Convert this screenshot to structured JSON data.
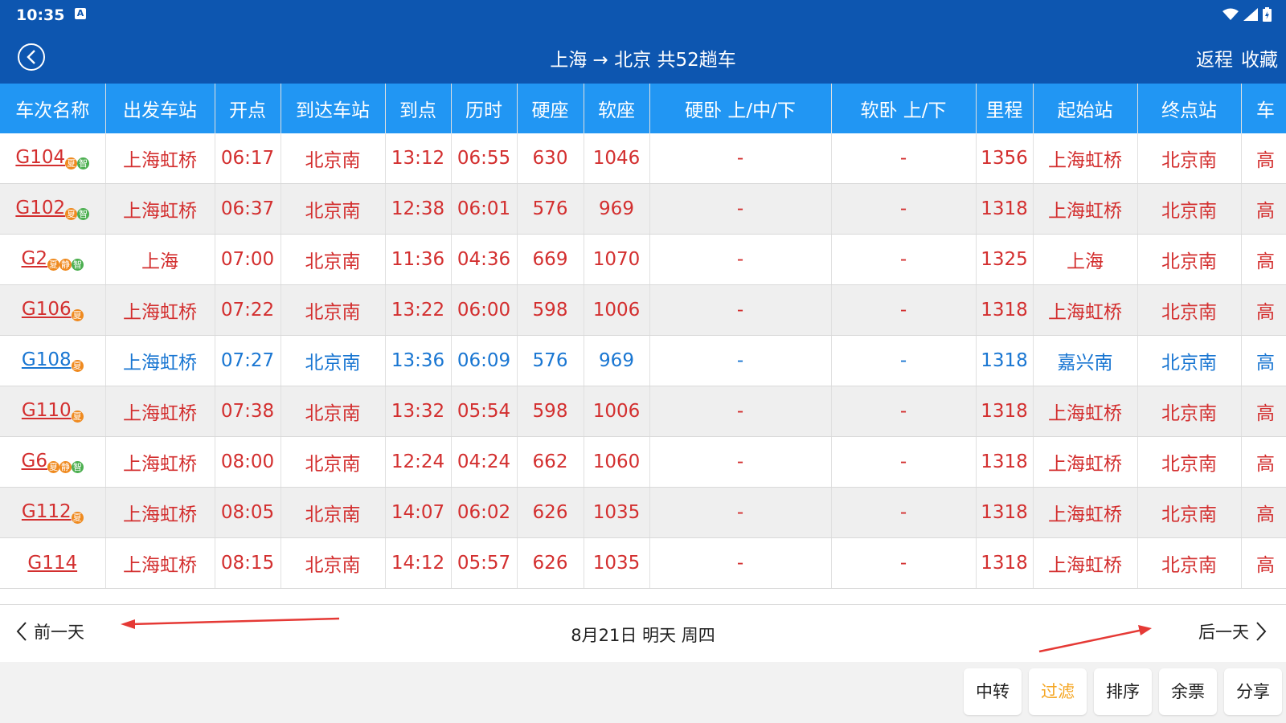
{
  "statusbar": {
    "time": "10:35",
    "a_icon": "A"
  },
  "appbar": {
    "title": "上海 → 北京 共52趟车",
    "return_label": "返程",
    "favorite_label": "收藏"
  },
  "table": {
    "headers": [
      "车次名称",
      "出发车站",
      "开点",
      "到达车站",
      "到点",
      "历时",
      "硬座",
      "软座",
      "硬卧 上/中/下",
      "软卧 上/下",
      "里程",
      "起始站",
      "终点站",
      "车"
    ],
    "rows": [
      {
        "code": "G104",
        "badges": [
          "夏",
          "智"
        ],
        "from": "上海虹桥",
        "dep": "06:17",
        "to": "北京南",
        "arr": "13:12",
        "dur": "06:55",
        "hard_seat": "630",
        "soft_seat": "1046",
        "hard_sleeper": "-",
        "soft_sleeper": "-",
        "km": "1356",
        "origin": "上海虹桥",
        "terminal": "北京南",
        "type": "高",
        "color": "red"
      },
      {
        "code": "G102",
        "badges": [
          "夏",
          "智"
        ],
        "from": "上海虹桥",
        "dep": "06:37",
        "to": "北京南",
        "arr": "12:38",
        "dur": "06:01",
        "hard_seat": "576",
        "soft_seat": "969",
        "hard_sleeper": "-",
        "soft_sleeper": "-",
        "km": "1318",
        "origin": "上海虹桥",
        "terminal": "北京南",
        "type": "高",
        "color": "red"
      },
      {
        "code": "G2",
        "badges": [
          "夏",
          "静",
          "智"
        ],
        "from": "上海",
        "dep": "07:00",
        "to": "北京南",
        "arr": "11:36",
        "dur": "04:36",
        "hard_seat": "669",
        "soft_seat": "1070",
        "hard_sleeper": "-",
        "soft_sleeper": "-",
        "km": "1325",
        "origin": "上海",
        "terminal": "北京南",
        "type": "高",
        "color": "red"
      },
      {
        "code": "G106",
        "badges": [
          "夏"
        ],
        "from": "上海虹桥",
        "dep": "07:22",
        "to": "北京南",
        "arr": "13:22",
        "dur": "06:00",
        "hard_seat": "598",
        "soft_seat": "1006",
        "hard_sleeper": "-",
        "soft_sleeper": "-",
        "km": "1318",
        "origin": "上海虹桥",
        "terminal": "北京南",
        "type": "高",
        "color": "red"
      },
      {
        "code": "G108",
        "badges": [
          "夏"
        ],
        "from": "上海虹桥",
        "dep": "07:27",
        "to": "北京南",
        "arr": "13:36",
        "dur": "06:09",
        "hard_seat": "576",
        "soft_seat": "969",
        "hard_sleeper": "-",
        "soft_sleeper": "-",
        "km": "1318",
        "origin": "嘉兴南",
        "terminal": "北京南",
        "type": "高",
        "color": "blue"
      },
      {
        "code": "G110",
        "badges": [
          "夏"
        ],
        "from": "上海虹桥",
        "dep": "07:38",
        "to": "北京南",
        "arr": "13:32",
        "dur": "05:54",
        "hard_seat": "598",
        "soft_seat": "1006",
        "hard_sleeper": "-",
        "soft_sleeper": "-",
        "km": "1318",
        "origin": "上海虹桥",
        "terminal": "北京南",
        "type": "高",
        "color": "red"
      },
      {
        "code": "G6",
        "badges": [
          "夏",
          "静",
          "智"
        ],
        "from": "上海虹桥",
        "dep": "08:00",
        "to": "北京南",
        "arr": "12:24",
        "dur": "04:24",
        "hard_seat": "662",
        "soft_seat": "1060",
        "hard_sleeper": "-",
        "soft_sleeper": "-",
        "km": "1318",
        "origin": "上海虹桥",
        "terminal": "北京南",
        "type": "高",
        "color": "red"
      },
      {
        "code": "G112",
        "badges": [
          "夏"
        ],
        "from": "上海虹桥",
        "dep": "08:05",
        "to": "北京南",
        "arr": "14:07",
        "dur": "06:02",
        "hard_seat": "626",
        "soft_seat": "1035",
        "hard_sleeper": "-",
        "soft_sleeper": "-",
        "km": "1318",
        "origin": "上海虹桥",
        "terminal": "北京南",
        "type": "高",
        "color": "red"
      },
      {
        "code": "G114",
        "badges": [],
        "from": "上海虹桥",
        "dep": "08:15",
        "to": "北京南",
        "arr": "14:12",
        "dur": "05:57",
        "hard_seat": "626",
        "soft_seat": "1035",
        "hard_sleeper": "-",
        "soft_sleeper": "-",
        "km": "1318",
        "origin": "上海虹桥",
        "terminal": "北京南",
        "type": "高",
        "color": "red"
      }
    ]
  },
  "datebar": {
    "prev_label": "前一天",
    "date_label": "8月21日 明天 周四",
    "next_label": "后一天"
  },
  "toolbar": {
    "transfer": "中转",
    "filter": "过滤",
    "sort": "排序",
    "tickets": "余票",
    "share": "分享"
  },
  "colors": {
    "primary": "#0d56b0",
    "header": "#2196f3",
    "train_red": "#d32f2f",
    "train_blue": "#1976d2",
    "filter_active": "#f5a623",
    "annotation_arrow": "#e53935"
  },
  "icons": {
    "back": "circle-back-arrow-icon",
    "wifi": "wifi-icon",
    "signal": "signal-icon",
    "battery": "battery-icon",
    "prev": "chevron-left-icon",
    "next": "chevron-right-icon"
  }
}
